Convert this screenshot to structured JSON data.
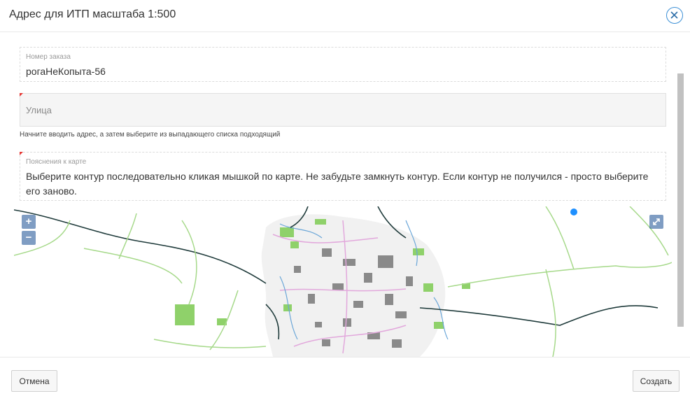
{
  "dialog": {
    "title": "Адрес для ИТП масштаба 1:500",
    "close_icon": "close-icon"
  },
  "form": {
    "order_number": {
      "label": "Номер заказа",
      "value": "рогаНеКопыта-56"
    },
    "street": {
      "placeholder": "Улица",
      "value": "",
      "hint": "Начните вводить адрес, а затем выберите из выпадающего списка подходящий"
    },
    "map_notes": {
      "label": "Пояснения к карте",
      "value": "Выберите контур последовательно кликая мышкой по карте. Не забудьте замкнуть контур. Если контур не получился - просто выберите его заново."
    }
  },
  "map": {
    "zoom_in_label": "+",
    "zoom_out_label": "−",
    "fullscreen_icon": "expand-icon",
    "marker_color": "#1e90ff"
  },
  "footer": {
    "cancel_label": "Отмена",
    "create_label": "Создать"
  },
  "colors": {
    "accent": "#3b8fd6",
    "required": "#e53935"
  }
}
